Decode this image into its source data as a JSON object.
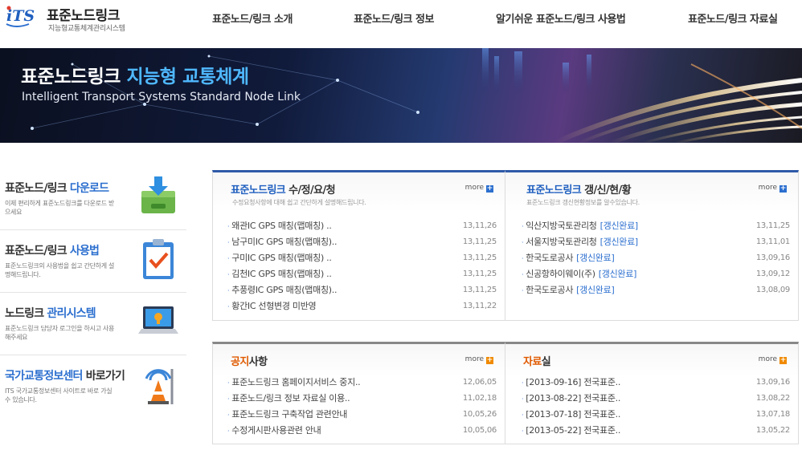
{
  "header": {
    "logo_mark": "iTS",
    "logo_title": "표준노드링크",
    "logo_sub": "지능형교통체계관리시스템",
    "nav": [
      {
        "label": "표준노드/링크 소개"
      },
      {
        "label": "표준노드/링크 정보"
      },
      {
        "label": "알기쉬운 표준노드/링크 사용법"
      },
      {
        "label": "표준노드/링크 자료실"
      }
    ]
  },
  "banner": {
    "title_main": "표준노드링크 ",
    "title_highlight": "지능형 교통체계",
    "subtitle": "Intelligent Transport Systems Standard Node Link"
  },
  "quick_menu": [
    {
      "title": "표준노드/링크 ",
      "title_highlight": "다운로드",
      "desc": "이제 편리하게 표준노드링크를 다운로드 받으세요",
      "icon": "download-box-icon"
    },
    {
      "title": "표준노드/링크 ",
      "title_highlight": "사용법",
      "desc": "표준노드링크의 사용법을 쉽고 간단하게 설명해드립니다.",
      "icon": "clipboard-check-icon"
    },
    {
      "title": "노드링크 ",
      "title_highlight": "관리시스템",
      "desc": "표준노드링크 담당자 로그인을 하시고 사용해주세요",
      "icon": "laptop-icon"
    },
    {
      "title": "국가교통정보센터",
      "title_highlight": " 바로가기",
      "desc": "ITS 국가교통정보센터 사이트로 바로 가실 수 있습니다.",
      "icon": "traffic-signal-icon"
    }
  ],
  "boards": {
    "correction": {
      "title_hl": "표준노드링크",
      "title_rest": " 수/정/요/청",
      "desc": "수정요청사항에 대해 쉽고 간단하게 설명해드립니다.",
      "more": "more",
      "items": [
        {
          "text": "왜관IC GPS 매칭(맵매칭) ..",
          "date": "13,11,26"
        },
        {
          "text": "남구미IC GPS 매칭(맵매칭)..",
          "date": "13,11,25"
        },
        {
          "text": "구미IC GPS 매칭(맵매칭) ..",
          "date": "13,11,25"
        },
        {
          "text": "김천IC GPS 매칭(맵매칭) ..",
          "date": "13,11,25"
        },
        {
          "text": "추풍령IC GPS 매칭(맵매칭)..",
          "date": "13,11,25"
        },
        {
          "text": "황간IC 선형변경 미반영",
          "date": "13,11,22"
        }
      ]
    },
    "update": {
      "title_hl": "표준노드링크",
      "title_rest": " 갱/신/현/황",
      "desc": "표준노드링크 갱신현황정보를 알수있습니다.",
      "more": "more",
      "items": [
        {
          "text": "익산지방국토관리청",
          "tag": "[갱신완료]",
          "date": "13,11,25"
        },
        {
          "text": "서울지방국토관리청",
          "tag": "[갱신완료]",
          "date": "13,11,01"
        },
        {
          "text": "한국도로공사",
          "tag": "[갱신완료]",
          "date": "13,09,16"
        },
        {
          "text": "신공항하이웨이(주)",
          "tag": "[갱신완료]",
          "date": "13,09,12"
        },
        {
          "text": "한국도로공사",
          "tag": "[갱신완료]",
          "date": "13,08,09"
        }
      ]
    },
    "notice": {
      "title_hl": "공지",
      "title_rest": "사항",
      "more": "more",
      "items": [
        {
          "text": "표준노드링크 홈페이지서비스 중지..",
          "date": "12,06,05"
        },
        {
          "text": "표준노드/링크 정보 자료실 이용..",
          "date": "11,02,18"
        },
        {
          "text": "표준노드링크 구축작업 관련안내",
          "date": "10,05,26"
        },
        {
          "text": "수정게시판사용관련 안내",
          "date": "10,05,06"
        }
      ]
    },
    "archive": {
      "title_hl": "자료",
      "title_rest": "실",
      "more": "more",
      "items": [
        {
          "text": "[2013-09-16] 전국표준..",
          "date": "13,09,16"
        },
        {
          "text": "[2013-08-22] 전국표준..",
          "date": "13,08,22"
        },
        {
          "text": "[2013-07-18] 전국표준..",
          "date": "13,07,18"
        },
        {
          "text": "[2013-05-22] 전국표준..",
          "date": "13,05,22"
        }
      ]
    }
  }
}
